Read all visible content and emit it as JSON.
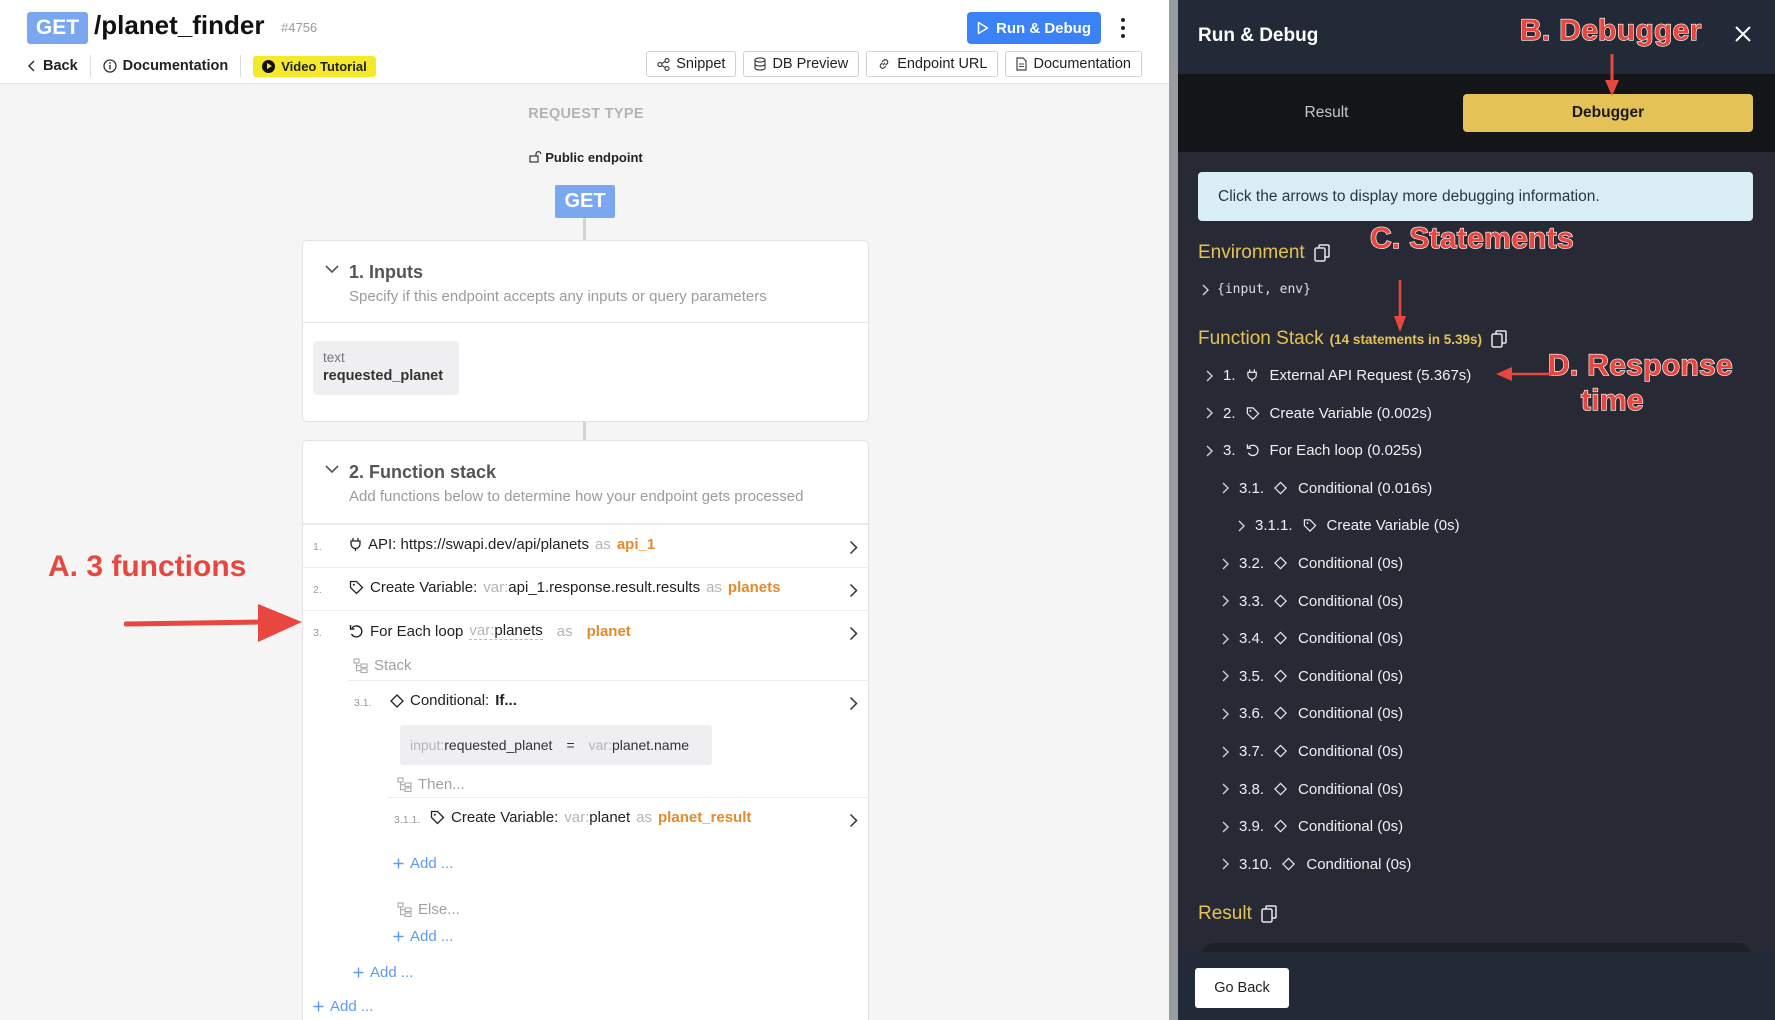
{
  "header": {
    "method": "GET",
    "path": "/planet_finder",
    "id": "#4756",
    "run_label": "Run & Debug",
    "back": "Back",
    "documentation": "Documentation",
    "video_tutorial": "Video Tutorial",
    "tools": [
      "Snippet",
      "DB Preview",
      "Endpoint URL",
      "Documentation"
    ]
  },
  "request": {
    "type_label": "REQUEST TYPE",
    "access": "Public endpoint",
    "method": "GET"
  },
  "inputs": {
    "title": "1. Inputs",
    "subtitle": "Specify if this endpoint accepts any inputs or query parameters",
    "chip_type": "text",
    "chip_name": "requested_planet"
  },
  "function_stack": {
    "title": "2. Function stack",
    "subtitle": "Add functions below to determine how your endpoint gets processed",
    "rows": [
      {
        "num": "1.",
        "label": "API: https://swapi.dev/api/planets",
        "as": "as",
        "var": "api_1"
      },
      {
        "num": "2.",
        "label": "Create Variable:",
        "kw": "var:",
        "value": "api_1.response.result.results",
        "as": "as",
        "var": "planets"
      },
      {
        "num": "3.",
        "label": "For Each loop",
        "kw": "var:",
        "value": "planets",
        "as": "as",
        "var": "planet"
      }
    ],
    "stack_label": "Stack",
    "cond_num": "3.1.",
    "cond_label": "Conditional:",
    "cond_if": "If...",
    "cond_left_kw": "input:",
    "cond_left": "requested_planet",
    "cond_op": "=",
    "cond_right_kw": "var:",
    "cond_right": "planet.name",
    "then_label": "Then...",
    "inner_num": "3.1.1.",
    "inner_label": "Create Variable:",
    "inner_kw": "var:",
    "inner_value": "planet",
    "inner_as": "as",
    "inner_var": "planet_result",
    "add_label": "Add ...",
    "else_label": "Else..."
  },
  "debug_panel": {
    "title": "Run & Debug",
    "tab_result": "Result",
    "tab_debugger": "Debugger",
    "info": "Click the arrows to display more debugging information.",
    "environment": "Environment",
    "env_value": "{input, env}",
    "function_stack": "Function Stack",
    "stats": "(14 statements in 5.39s)",
    "items": [
      {
        "num": "1.",
        "label": "External API Request (5.367s)"
      },
      {
        "num": "2.",
        "label": "Create Variable (0.002s)"
      },
      {
        "num": "3.",
        "label": "For Each loop (0.025s)"
      },
      {
        "num": "3.1.",
        "label": "Conditional (0.016s)"
      },
      {
        "num": "3.1.1.",
        "label": "Create Variable (0s)"
      },
      {
        "num": "3.2.",
        "label": "Conditional (0s)"
      },
      {
        "num": "3.3.",
        "label": "Conditional (0s)"
      },
      {
        "num": "3.4.",
        "label": "Conditional (0s)"
      },
      {
        "num": "3.5.",
        "label": "Conditional (0s)"
      },
      {
        "num": "3.6.",
        "label": "Conditional (0s)"
      },
      {
        "num": "3.7.",
        "label": "Conditional (0s)"
      },
      {
        "num": "3.8.",
        "label": "Conditional (0s)"
      },
      {
        "num": "3.9.",
        "label": "Conditional (0s)"
      },
      {
        "num": "3.10.",
        "label": "Conditional (0s)"
      }
    ],
    "result": "Result",
    "go_back": "Go Back"
  },
  "annotations": {
    "a": "A.  3 functions",
    "b": "B. Debugger",
    "c": "C. Statements",
    "d1": "D. Response",
    "d2": "time"
  },
  "colors": {
    "accent": "#3b82f6",
    "debugger_tab": "#e5c255",
    "annotation": "#e8473f",
    "var_highlight": "#e58a2c"
  }
}
